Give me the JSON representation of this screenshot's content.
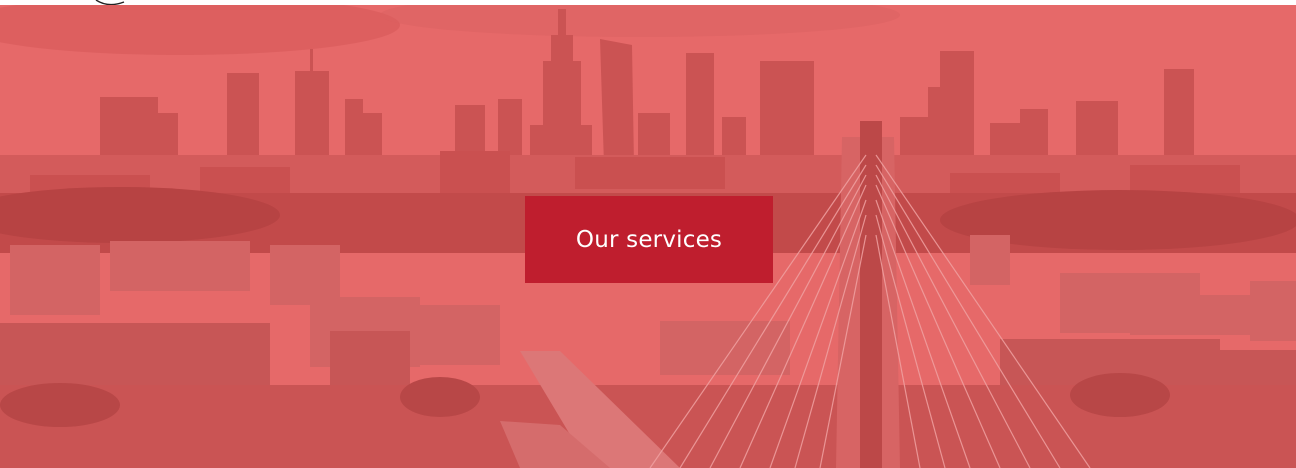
{
  "hero": {
    "cta_label": "Our services"
  },
  "colors": {
    "overlay": "#e56c6c",
    "button": "#bf1e2e",
    "button_text": "#ffffff"
  },
  "icons": {
    "skyline": "city-skyline-image",
    "bridge": "cable-stayed-bridge"
  }
}
